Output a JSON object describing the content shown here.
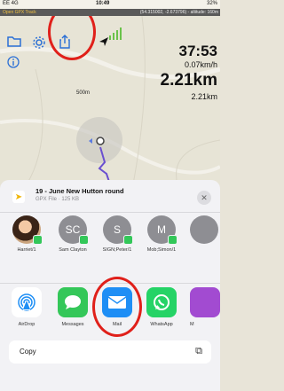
{
  "status_bar": {
    "carrier": "EE 4G",
    "time": "10:49",
    "battery": "32%"
  },
  "app_bar": {
    "track_label": "Open GPX Track",
    "coords": "(54.315002, -2.673796) - altitude: 160m"
  },
  "map": {
    "scale_label": "500m",
    "stats": {
      "time": "37:53",
      "speed": "0.07km/h",
      "distance": "2.21km",
      "distance_small": "2.21km"
    }
  },
  "share_sheet": {
    "file_title": "19 - June New Hutton round",
    "file_subtitle": "GPX File · 125 KB",
    "people": [
      {
        "initials": "",
        "name": "Harriet/1"
      },
      {
        "initials": "SC",
        "name": "Sam Clayton"
      },
      {
        "initials": "S",
        "name": "SIGN;Peter/1"
      },
      {
        "initials": "M",
        "name": "Mob;Simon/1"
      },
      {
        "initials": "",
        "name": ""
      }
    ],
    "apps": [
      {
        "name": "AirDrop",
        "icon": "airdrop-icon",
        "color": "#ffffff"
      },
      {
        "name": "Messages",
        "icon": "messages-icon",
        "color": "#34c759"
      },
      {
        "name": "Mail",
        "icon": "mail-icon",
        "color": "#1e8ef5"
      },
      {
        "name": "WhatsApp",
        "icon": "whatsapp-icon",
        "color": "#25d366"
      },
      {
        "name": "M",
        "icon": "app-icon",
        "color": "#a24bd1"
      }
    ],
    "copy_label": "Copy"
  }
}
